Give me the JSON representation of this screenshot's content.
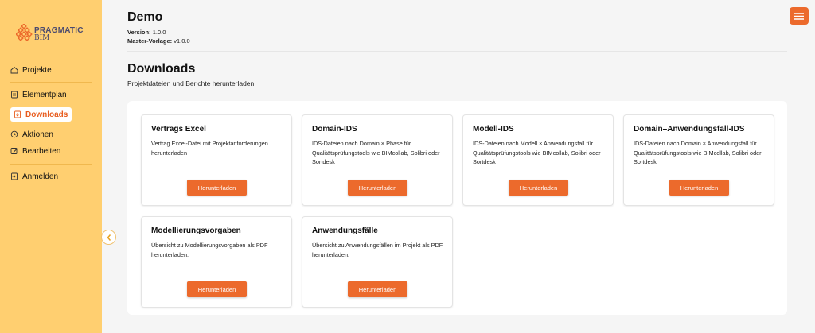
{
  "brand": {
    "line1": "PRAGMATIC",
    "line2": "BIM"
  },
  "sidebar": {
    "items": [
      {
        "label": "Projekte",
        "icon": "home-icon"
      },
      {
        "label": "Elementplan",
        "icon": "document-icon"
      },
      {
        "label": "Downloads",
        "icon": "download-icon",
        "active": true
      },
      {
        "label": "Aktionen",
        "icon": "action-icon"
      },
      {
        "label": "Bearbeiten",
        "icon": "edit-icon"
      },
      {
        "label": "Anmelden",
        "icon": "login-icon"
      }
    ]
  },
  "header": {
    "title": "Demo",
    "version_label": "Version:",
    "version_value": "1.0.0",
    "master_label": "Master-Vorlage:",
    "master_value": "v1.0.0"
  },
  "section": {
    "title": "Downloads",
    "subtitle": "Projektdateien und Berichte herunterladen"
  },
  "cards": [
    {
      "title": "Vertrags Excel",
      "description": "Vertrag Excel-Datei mit Projektanforderungen herunterladen",
      "button": "Herunterladen"
    },
    {
      "title": "Domain-IDS",
      "description": "IDS-Dateien nach Domain × Phase für Qualitätsprüfungstools wie BIMcollab, Solibri oder Sortdesk",
      "button": "Herunterladen"
    },
    {
      "title": "Modell-IDS",
      "description": "IDS-Dateien nach Modell × Anwendungsfall für Qualitätsprüfungstools wie BIMcollab, Solibri oder Sortdesk",
      "button": "Herunterladen"
    },
    {
      "title": "Domain–Anwendungsfall-IDS",
      "description": "IDS-Dateien nach Domain × Anwendungsfall für Qualitätsprüfungstools wie BIMcollab, Solibri oder Sortdesk",
      "button": "Herunterladen"
    },
    {
      "title": "Modellierungsvorgaben",
      "description": "Übersicht zu Modellierungsvorgaben als PDF herunterladen.",
      "button": "Herunterladen"
    },
    {
      "title": "Anwendungsfälle",
      "description": "Übersicht zu Anwendungsfällen im Projekt als PDF herunterladen.",
      "button": "Herunterladen"
    }
  ],
  "colors": {
    "accent": "#ec6a2c",
    "sidebar": "#ffcf70",
    "brand_text": "#4b4a6e"
  }
}
